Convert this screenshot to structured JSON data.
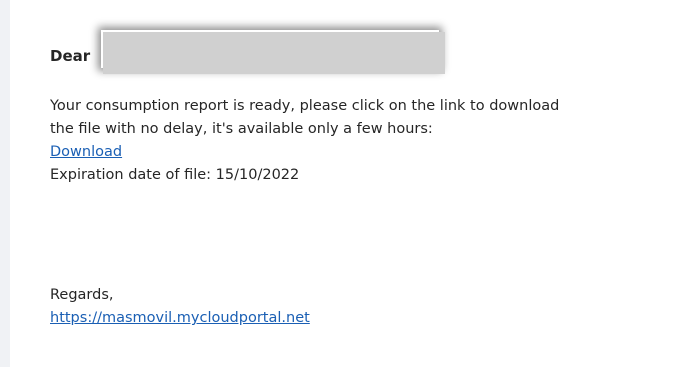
{
  "email": {
    "greeting": "Dear",
    "body_line_1": "Your consumption report is ready, please click on the link to download",
    "body_line_2": "the file with no delay, it's available only a few hours:",
    "download_link": "Download",
    "expiration": "Expiration date of file: 15/10/2022",
    "regards": "Regards,",
    "portal_link": "https://masmovil.mycloudportal.net"
  },
  "colors": {
    "link": "#1a5fb4",
    "text": "#262626",
    "redaction": "#d0d0d0",
    "rail": "#f0f2f5"
  }
}
